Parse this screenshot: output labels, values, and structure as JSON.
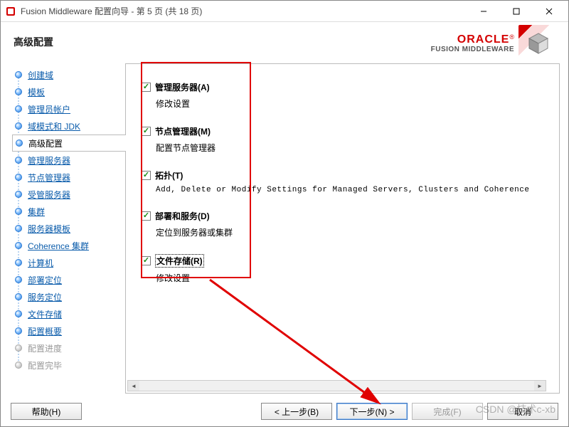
{
  "window": {
    "title": "Fusion Middleware 配置向导 - 第 5 页 (共 18 页)"
  },
  "brand": {
    "oracle": "ORACLE",
    "product": "FUSION MIDDLEWARE"
  },
  "header": {
    "page_title": "高级配置"
  },
  "nav": {
    "items": [
      {
        "label": "创建域",
        "state": "done"
      },
      {
        "label": "模板",
        "state": "done"
      },
      {
        "label": "管理员帐户",
        "state": "done"
      },
      {
        "label": "域模式和 JDK",
        "state": "done"
      },
      {
        "label": "高级配置",
        "state": "current"
      },
      {
        "label": "管理服务器",
        "state": "done"
      },
      {
        "label": "节点管理器",
        "state": "done"
      },
      {
        "label": "受管服务器",
        "state": "done"
      },
      {
        "label": "集群",
        "state": "done"
      },
      {
        "label": "服务器模板",
        "state": "done"
      },
      {
        "label": "Coherence 集群",
        "state": "done"
      },
      {
        "label": "计算机",
        "state": "done"
      },
      {
        "label": "部署定位",
        "state": "done"
      },
      {
        "label": "服务定位",
        "state": "done"
      },
      {
        "label": "文件存储",
        "state": "done"
      },
      {
        "label": "配置概要",
        "state": "done"
      },
      {
        "label": "配置进度",
        "state": "future"
      },
      {
        "label": "配置完毕",
        "state": "future"
      }
    ]
  },
  "options": [
    {
      "checked": true,
      "label": "管理服务器(A)",
      "mn": "A",
      "desc": "修改设置",
      "desc_class": ""
    },
    {
      "checked": true,
      "label": "节点管理器(M)",
      "mn": "M",
      "desc": "配置节点管理器",
      "desc_class": ""
    },
    {
      "checked": true,
      "label": "拓扑(T)",
      "mn": "T",
      "desc": "Add, Delete or Modify Settings for Managed Servers, Clusters and Coherence",
      "desc_class": "en"
    },
    {
      "checked": true,
      "label": "部署和服务(D)",
      "mn": "D",
      "desc": "定位到服务器或集群",
      "desc_class": ""
    },
    {
      "checked": true,
      "label": "文件存储(R)",
      "mn": "R",
      "desc": "修改设置",
      "desc_class": "",
      "focus": true
    }
  ],
  "footer": {
    "help": "帮助(H)",
    "back": "< 上一步(B)",
    "next": "下一步(N) >",
    "finish": "完成(F)",
    "cancel": "取消"
  },
  "watermark": "CSDN @技术c-xb"
}
